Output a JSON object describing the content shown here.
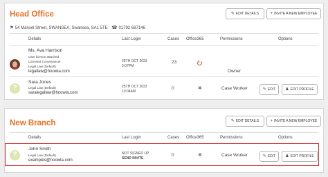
{
  "buttons": {
    "edit_details": "EDIT DETAILS",
    "invite_new_employee": "INVITE A NEW EMPLOYEE",
    "edit": "EDIT",
    "edit_profile": "EDIT PROFILE"
  },
  "columns": {
    "details": "Details",
    "last_login": "Last Login",
    "cases": "Cases",
    "office365": "Office365",
    "permissions": "Permissions",
    "options": "Options"
  },
  "head_office": {
    "title": "Head Office",
    "address": "54 Mansel Street, SWANSEA, Swansea, SA1 5TE",
    "phone": "01792 687146",
    "employees": [
      {
        "name": "Ms. Ava Harrison",
        "meta": [
          "User licence attached",
          "Licensed Conveyancer",
          "Legal Law (Default)"
        ],
        "email": "legallaw@hoowla.com",
        "last_login_date": "25TH OCT 2023",
        "last_login_time": "5:07PM",
        "cases": "23",
        "permission": "Owner"
      },
      {
        "name": "Sara Jones",
        "meta": [
          "Legal Law (Default)"
        ],
        "email": "saralegallaw@hoowla.com",
        "last_login_date": "25TH OCT 2023",
        "last_login_time": "10:04AM",
        "cases": "0",
        "permission": "Case Worker"
      }
    ]
  },
  "new_branch": {
    "title": "New Branch",
    "employees": [
      {
        "name": "John Smith",
        "meta": [
          "Legal Law (Default)"
        ],
        "email": "examples@hoowla.com",
        "last_login_date": "NOT SIGNED UP",
        "last_login_time": "SEND INVITE",
        "cases": "0",
        "permission": "Case Worker"
      }
    ]
  },
  "colors": {
    "accent": "#f37021",
    "highlight": "#d9262f",
    "office365_active": "#e4572e"
  },
  "icons": [
    "pencil-icon",
    "plus-icon",
    "location-icon",
    "phone-icon",
    "power-icon",
    "cross-icon",
    "user-icon"
  ]
}
